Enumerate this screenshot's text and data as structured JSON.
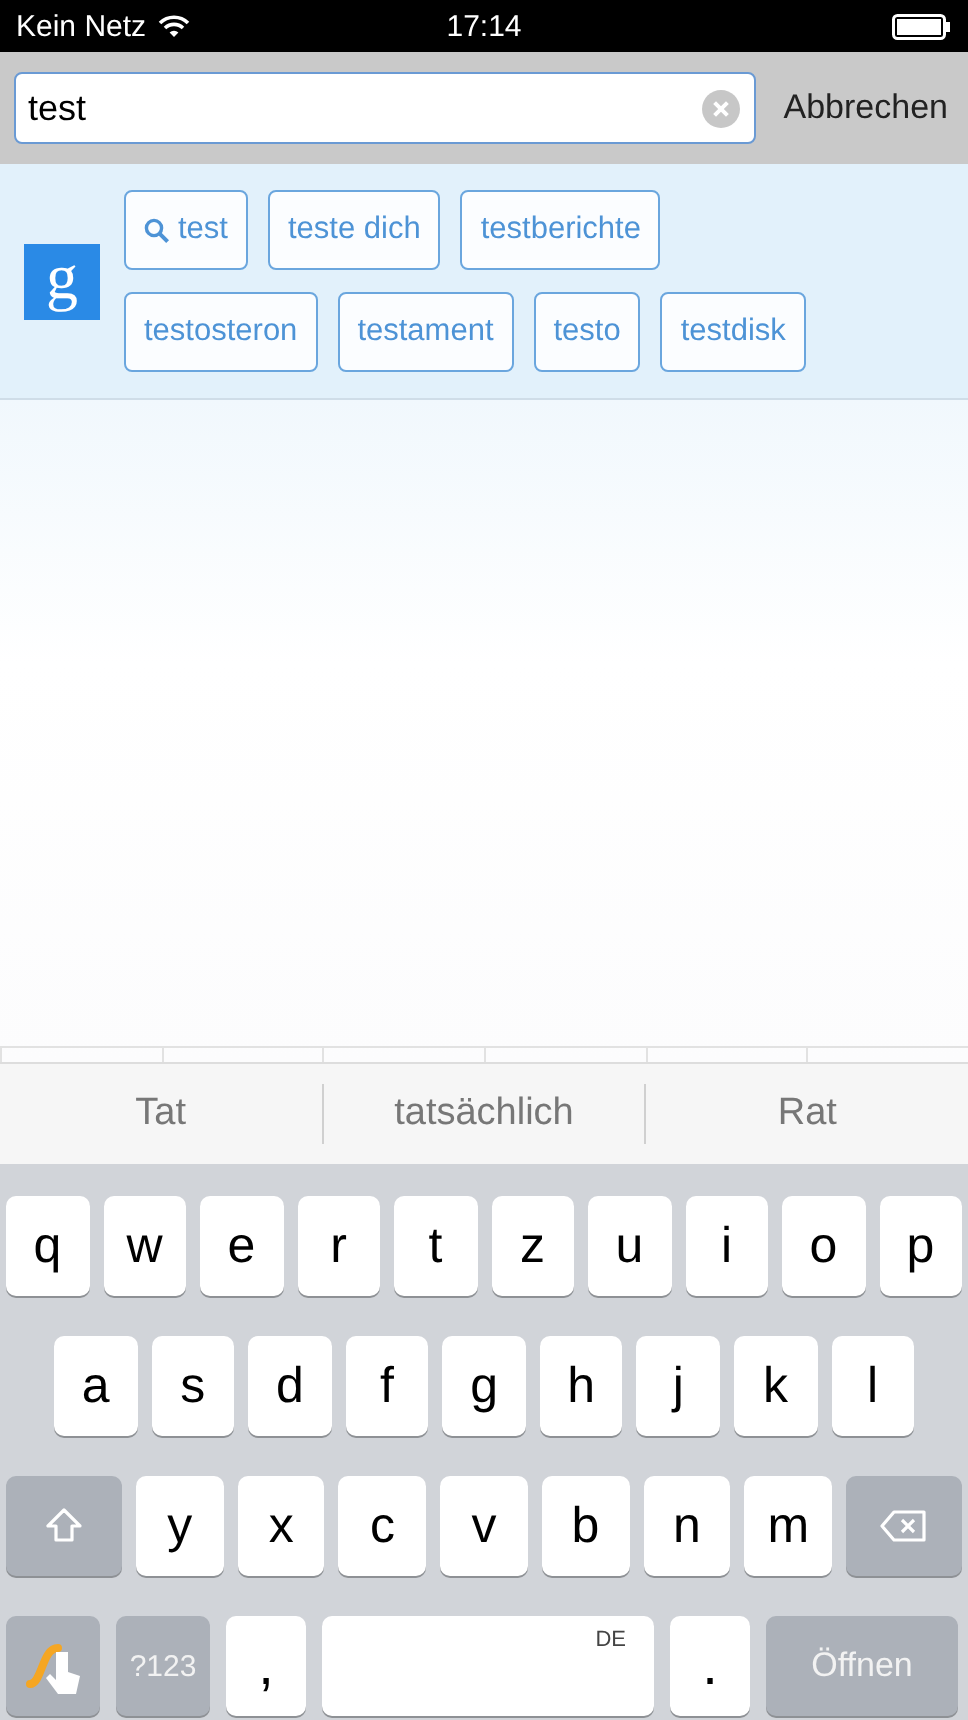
{
  "status_bar": {
    "carrier": "Kein Netz",
    "time": "17:14"
  },
  "search": {
    "value": "test",
    "cancel": "Abbrechen"
  },
  "suggestions": {
    "logo": "g",
    "chip_rows": [
      [
        {
          "label": "test",
          "kind": "search"
        },
        {
          "label": "teste dich",
          "kind": "plain"
        },
        {
          "label": "testberichte",
          "kind": "plain"
        }
      ],
      [
        {
          "label": "testosteron",
          "kind": "plain"
        },
        {
          "label": "testament",
          "kind": "plain"
        },
        {
          "label": "testo",
          "kind": "plain"
        },
        {
          "label": "testdisk",
          "kind": "plain"
        }
      ]
    ]
  },
  "predictions": [
    "Tat",
    "tatsächlich",
    "Rat"
  ],
  "keyboard": {
    "row_1": [
      {
        "kind": "letter",
        "label": "q"
      },
      {
        "kind": "letter",
        "label": "w"
      },
      {
        "kind": "letter",
        "label": "e"
      },
      {
        "kind": "letter",
        "label": "r"
      },
      {
        "kind": "letter",
        "label": "t"
      },
      {
        "kind": "letter",
        "label": "z"
      },
      {
        "kind": "letter",
        "label": "u"
      },
      {
        "kind": "letter",
        "label": "i"
      },
      {
        "kind": "letter",
        "label": "o"
      },
      {
        "kind": "letter",
        "label": "p"
      }
    ],
    "row_2": [
      {
        "kind": "letter",
        "label": "a"
      },
      {
        "kind": "letter",
        "label": "s"
      },
      {
        "kind": "letter",
        "label": "d"
      },
      {
        "kind": "letter",
        "label": "f"
      },
      {
        "kind": "letter",
        "label": "g"
      },
      {
        "kind": "letter",
        "label": "h"
      },
      {
        "kind": "letter",
        "label": "j"
      },
      {
        "kind": "letter",
        "label": "k"
      },
      {
        "kind": "letter",
        "label": "l"
      }
    ],
    "row_3": [
      {
        "kind": "shift"
      },
      {
        "kind": "letter",
        "label": "y"
      },
      {
        "kind": "letter",
        "label": "x"
      },
      {
        "kind": "letter",
        "label": "c"
      },
      {
        "kind": "letter",
        "label": "v"
      },
      {
        "kind": "letter",
        "label": "b"
      },
      {
        "kind": "letter",
        "label": "n"
      },
      {
        "kind": "letter",
        "label": "m"
      },
      {
        "kind": "delete"
      }
    ],
    "bottom_row": [
      {
        "kind": "swipe"
      },
      {
        "kind": "mode",
        "label": "?123"
      },
      {
        "kind": "punct",
        "label": ","
      },
      {
        "kind": "space",
        "label": "DE"
      },
      {
        "kind": "punct",
        "label": "."
      },
      {
        "kind": "action",
        "label": "Öffnen"
      }
    ]
  }
}
